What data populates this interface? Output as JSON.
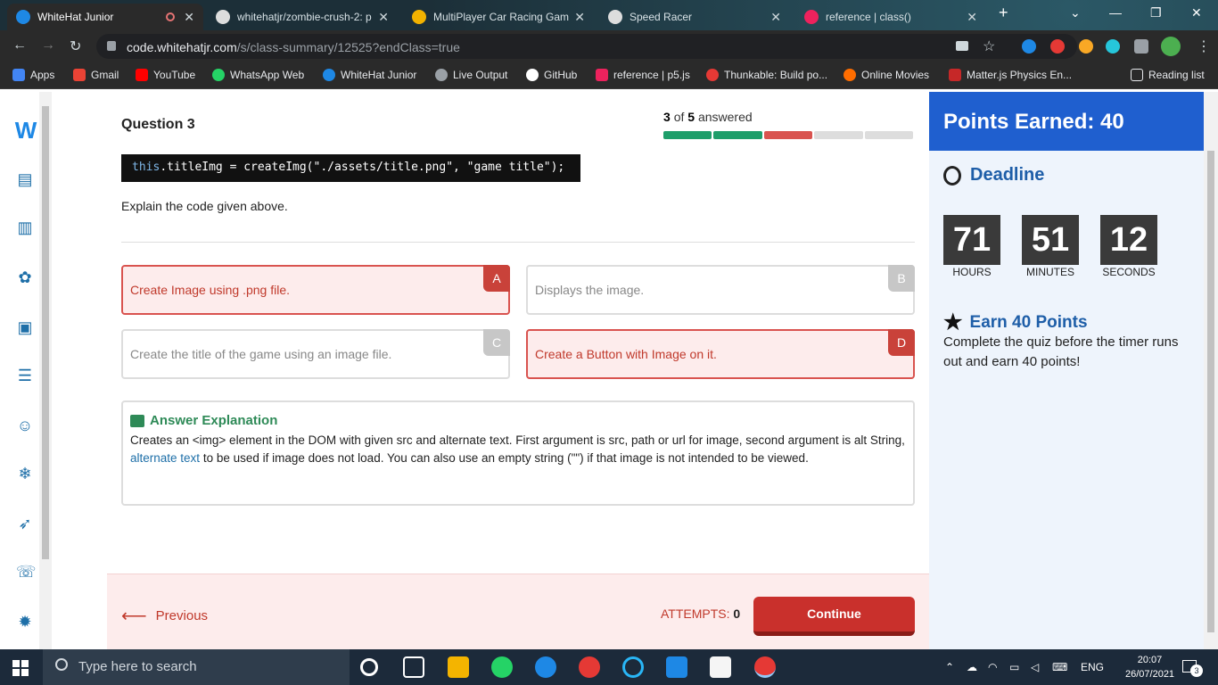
{
  "browser": {
    "tabs": [
      {
        "title": "WhiteHat Junior",
        "color": "#1e88e5",
        "active": true
      },
      {
        "title": "whitehatjr/zombie-crush-2: p",
        "color": "#dddddd",
        "active": false
      },
      {
        "title": "MultiPlayer Car Racing Game",
        "color": "#f2b200",
        "active": false
      },
      {
        "title": "Speed Racer",
        "color": "#dddddd",
        "active": false
      },
      {
        "title": "reference | class()",
        "color": "#ed225d",
        "active": false
      }
    ],
    "url_host": "code.whitehatjr.com",
    "url_path": "/s/class-summary/12525?endClass=true",
    "bookmarks": [
      {
        "label": "Apps",
        "color": "#4285f4"
      },
      {
        "label": "Gmail",
        "color": "#ea4335"
      },
      {
        "label": "YouTube",
        "color": "#ff0000"
      },
      {
        "label": "WhatsApp Web",
        "color": "#25d366"
      },
      {
        "label": "WhiteHat Junior",
        "color": "#1e88e5"
      },
      {
        "label": "Live Output",
        "color": "#9aa0a6"
      },
      {
        "label": "GitHub",
        "color": "#ffffff"
      },
      {
        "label": "reference | p5.js",
        "color": "#ed225d"
      },
      {
        "label": "Thunkable: Build po...",
        "color": "#e53935"
      },
      {
        "label": "Online Movies",
        "color": "#ff6d00"
      },
      {
        "label": "Matter.js Physics En...",
        "color": "#c62828"
      }
    ],
    "reading_list": "Reading list"
  },
  "quiz": {
    "question_title": "Question 3",
    "answered_current": "3",
    "answered_of": "of",
    "answered_total": "5",
    "answered_word": "answered",
    "progress": [
      "correct",
      "correct",
      "wrong",
      "pending",
      "pending"
    ],
    "progress_colors": {
      "correct": "#1e9e6a",
      "wrong": "#d9534f",
      "pending": "#dddddd"
    },
    "code_lines": [
      {
        "kw": "this",
        "rest": ".titleImg = createImg(\"./assets/title.png\", \"game title\");"
      }
    ],
    "prompt": "Explain the code given above.",
    "options": [
      {
        "letter": "A",
        "text": "Create Image using .png file.",
        "state": "wrong"
      },
      {
        "letter": "B",
        "text": "Displays the image.",
        "state": "neutral"
      },
      {
        "letter": "C",
        "text": "Create the title of the game using an image file.",
        "state": "neutral"
      },
      {
        "letter": "D",
        "text": "Create a Button with Image on it.",
        "state": "wrong"
      }
    ],
    "explanation_title": "Answer Explanation",
    "explanation_part1": "Creates an <img> element in the DOM with given src and alternate text. First argument is src, path or url for image, second argument is alt String,",
    "explanation_link": "alternate text",
    "explanation_part2": "to be used if image does not load. You can also use an empty string (\"\") if that image is not intended to be viewed.",
    "previous_label": "Previous",
    "attempts_label": "ATTEMPTS:",
    "attempts_value": "0",
    "continue_label": "Continue"
  },
  "sidebar": {
    "points_label": "Points Earned:",
    "points_value": "40",
    "deadline_label": "Deadline",
    "timer": [
      {
        "value": "71",
        "label": "HOURS"
      },
      {
        "value": "51",
        "label": "MINUTES"
      },
      {
        "value": "12",
        "label": "SECONDS"
      }
    ],
    "earn_title": "Earn 40 Points",
    "earn_text": "Complete the quiz before the timer runs out and earn 40 points!"
  },
  "taskbar": {
    "search_placeholder": "Type here to search",
    "lang": "ENG",
    "time": "20:07",
    "date": "26/07/2021",
    "notif_count": "3"
  }
}
